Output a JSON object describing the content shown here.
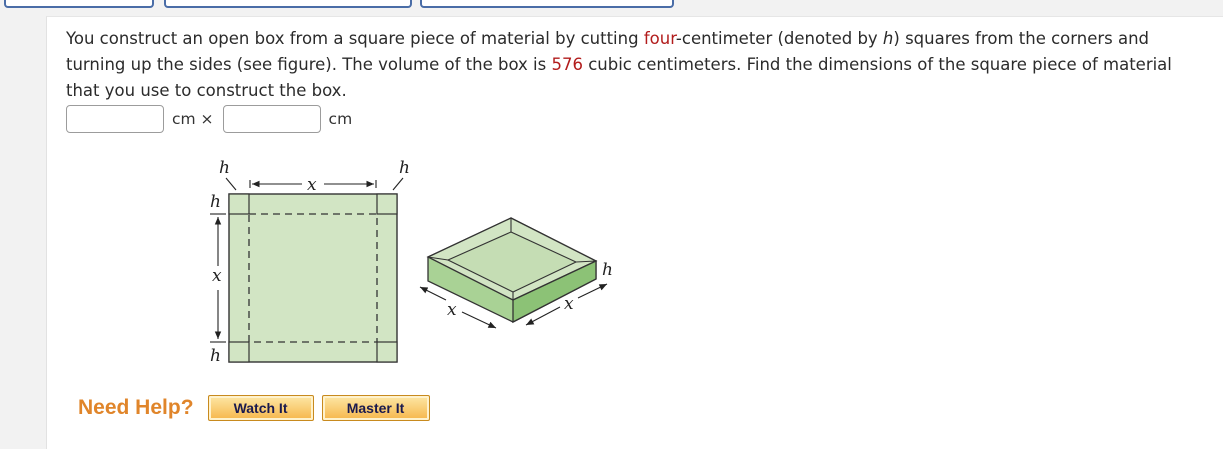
{
  "problem": {
    "part1": "You construct an open box from a square piece of material by cutting ",
    "cut_size": "four",
    "part2": "-centimeter (denoted by ",
    "var_h": "h",
    "part3": ") squares from the corners and turning up the sides (see figure). The volume of the box is ",
    "volume": "576",
    "part4": " cubic centimeters. Find the dimensions of the square piece of material that you use to construct the box."
  },
  "answer": {
    "input1_value": "",
    "unit1": "cm ×",
    "input2_value": "",
    "unit2": "cm"
  },
  "figure": {
    "label_h": "h",
    "label_x": "x"
  },
  "help": {
    "title": "Need Help?",
    "watch_label": "Watch It",
    "master_label": "Master It"
  },
  "colors": {
    "highlight": "#b21c1c",
    "material_fill": "#d2e5c4",
    "box_side": "#9bcb86",
    "button_border": "#c88a1e",
    "need_help": "#e0852a"
  }
}
